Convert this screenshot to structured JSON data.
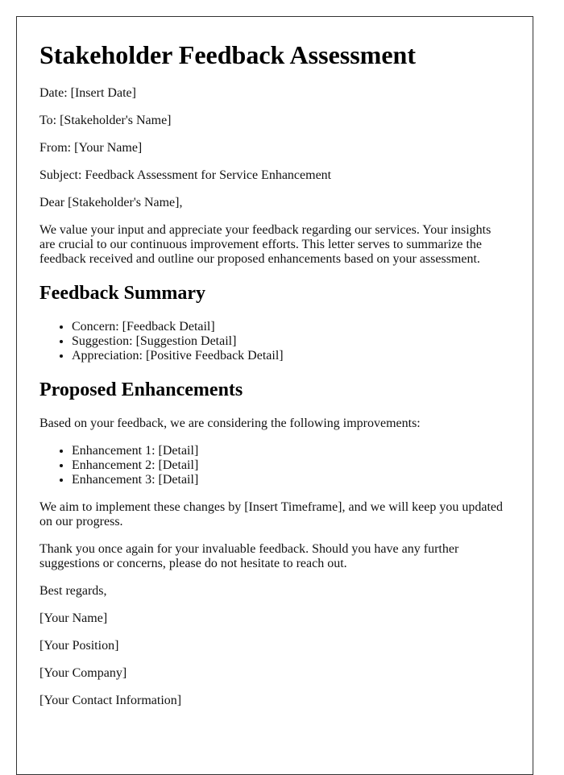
{
  "title": "Stakeholder Feedback Assessment",
  "header_fields": {
    "date": "Date: [Insert Date]",
    "to": "To: [Stakeholder's Name]",
    "from": "From: [Your Name]",
    "subject": "Subject: Feedback Assessment for Service Enhancement"
  },
  "salutation": "Dear [Stakeholder's Name],",
  "intro_paragraph": "We value your input and appreciate your feedback regarding our services. Your insights are crucial to our continuous improvement efforts. This letter serves to summarize the feedback received and outline our proposed enhancements based on your assessment.",
  "feedback_summary": {
    "heading": "Feedback Summary",
    "items": [
      "Concern: [Feedback Detail]",
      "Suggestion: [Suggestion Detail]",
      "Appreciation: [Positive Feedback Detail]"
    ]
  },
  "proposed_enhancements": {
    "heading": "Proposed Enhancements",
    "intro": "Based on your feedback, we are considering the following improvements:",
    "items": [
      "Enhancement 1: [Detail]",
      "Enhancement 2: [Detail]",
      "Enhancement 3: [Detail]"
    ]
  },
  "timeline_paragraph": "We aim to implement these changes by [Insert Timeframe], and we will keep you updated on our progress.",
  "thanks_paragraph": "Thank you once again for your invaluable feedback. Should you have any further suggestions or concerns, please do not hesitate to reach out.",
  "closing": "Best regards,",
  "signature": {
    "name": "[Your Name]",
    "position": "[Your Position]",
    "company": "[Your Company]",
    "contact": "[Your Contact Information]"
  }
}
